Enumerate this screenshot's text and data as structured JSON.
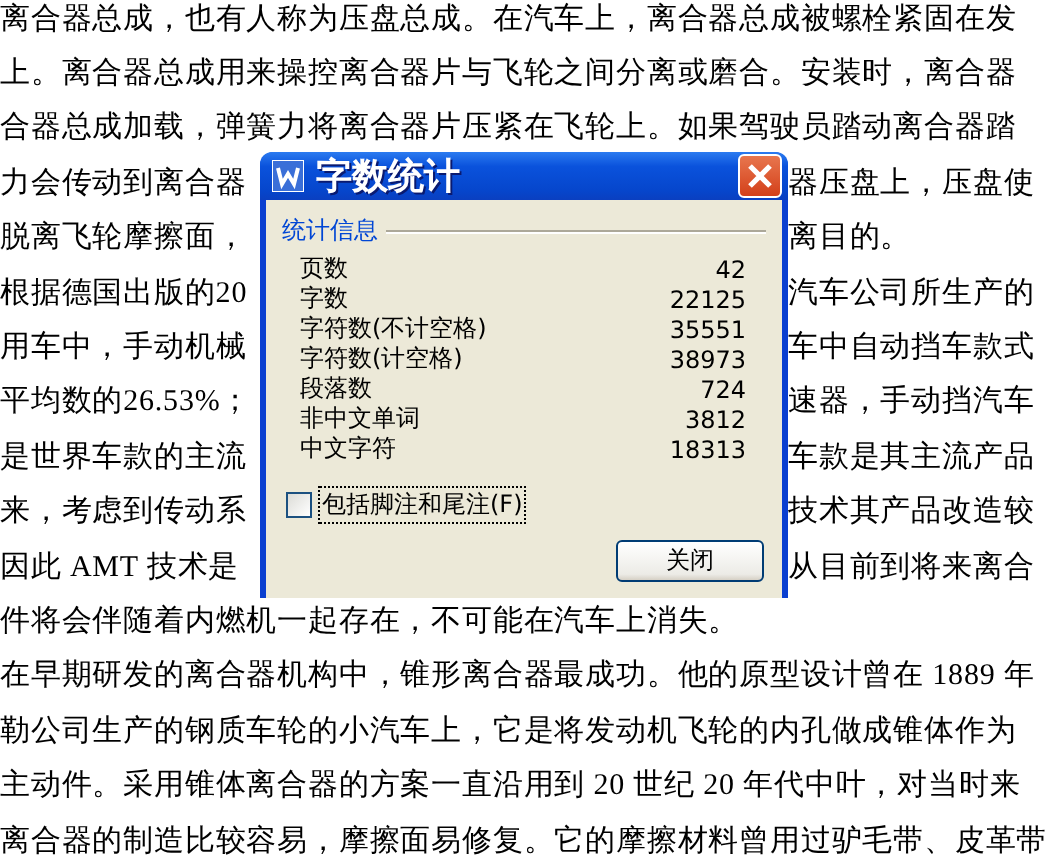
{
  "document": {
    "lines": [
      {
        "left": "离合器总成，也有人称为压盘总成。在汽车上，离合器总成被螺栓紧固在发"
      },
      {
        "left": "上。离合器总成用来操控离合器片与飞轮之间分离或磨合。安装时，离合器"
      },
      {
        "left": "合器总成加载，弹簧力将离合器片压紧在飞轮上。如果驾驶员踏动离合器踏"
      },
      {
        "left": "力会传动到离合器",
        "right": "器压盘上，压盘使"
      },
      {
        "left": "脱离飞轮摩擦面，",
        "right": "离目的。"
      },
      {
        "left": "根据德国出版的20",
        "right": "汽车公司所生产的"
      },
      {
        "left": "用车中，手动机械",
        "right": "车中自动挡车款式"
      },
      {
        "left": "平均数的26.53%；",
        "right": "速器，手动挡汽车"
      },
      {
        "left": "是世界车款的主流",
        "right": "车款是其主流产品"
      },
      {
        "left": "来，考虑到传动系",
        "right": "技术其产品改造较"
      },
      {
        "left": "因此 AMT 技术是",
        "right": "从目前到将来离合"
      },
      {
        "left": "件将会伴随着内燃机一起存在，不可能在汽车上消失。"
      },
      {
        "left": "在早期研发的离合器机构中，锥形离合器最成功。他的原型设计曾在 1889 年"
      },
      {
        "left": "勒公司生产的钢质车轮的小汽车上，它是将发动机飞轮的内孔做成锥体作为"
      },
      {
        "left": "主动件。采用锥体离合器的方案一直沿用到 20 世纪 20 年代中叶，对当时来"
      },
      {
        "left": "离合器的制造比较容易，摩擦面易修复。它的摩擦材料曾用过驴毛带、皮革带"
      }
    ]
  },
  "dialog": {
    "title": "字数统计",
    "group": "统计信息",
    "stats": [
      {
        "label": "页数",
        "value": "42"
      },
      {
        "label": "字数",
        "value": "22125"
      },
      {
        "label": "字符数(不计空格)",
        "value": "35551"
      },
      {
        "label": "字符数(计空格)",
        "value": "38973"
      },
      {
        "label": "段落数",
        "value": "724"
      },
      {
        "label": "非中文单词",
        "value": "3812"
      },
      {
        "label": "中文字符",
        "value": "18313"
      }
    ],
    "checkbox": {
      "label": "包括脚注和尾注(F)",
      "checked": false
    },
    "close_button": "关闭"
  }
}
